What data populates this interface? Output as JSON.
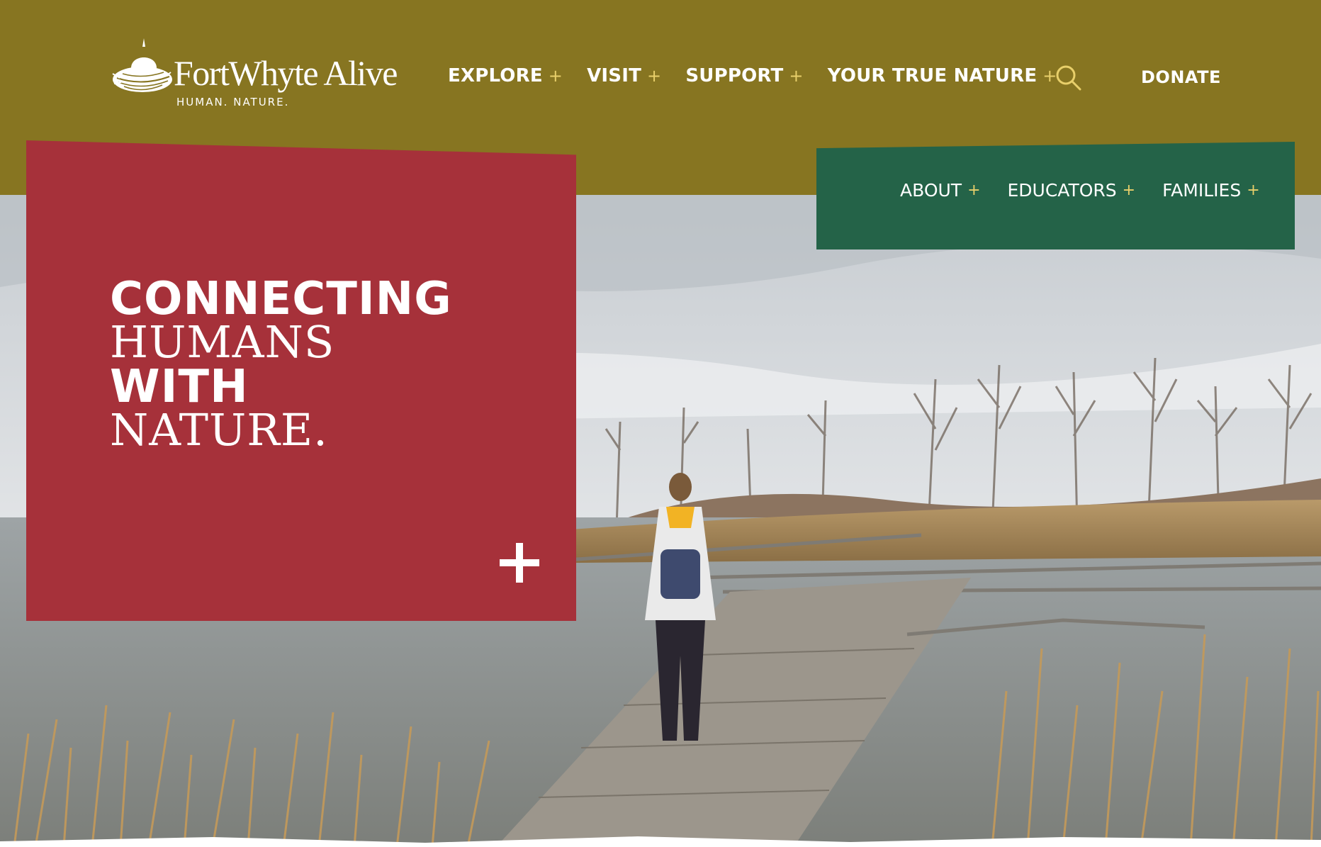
{
  "brand": {
    "name": "FortWhyte Alive",
    "tagline": "HUMAN. NATURE."
  },
  "nav": {
    "items": [
      {
        "label": "EXPLORE",
        "icon": "plus-icon"
      },
      {
        "label": "VISIT",
        "icon": "plus-icon"
      },
      {
        "label": "SUPPORT",
        "icon": "plus-icon"
      },
      {
        "label": "YOUR TRUE NATURE",
        "icon": "plus-icon"
      }
    ],
    "plus_symbol": "+",
    "search_icon": "search-icon",
    "donate_label": "DONATE"
  },
  "audience_nav": {
    "items": [
      {
        "label": "ABOUT"
      },
      {
        "label": "EDUCATORS"
      },
      {
        "label": "FAMILIES"
      }
    ]
  },
  "hero": {
    "headline": [
      {
        "text": "CONNECTING",
        "style": "bold"
      },
      {
        "text": "HUMANS",
        "style": "light"
      },
      {
        "text": "WITH",
        "style": "bold"
      },
      {
        "text": "NATURE.",
        "style": "light"
      }
    ],
    "expand_icon": "plus-icon"
  },
  "colors": {
    "header_bg": "#877521",
    "card_red": "#a6313a",
    "nav_green": "#246348",
    "accent_gold": "#e8cf6a",
    "text": "#ffffff"
  }
}
